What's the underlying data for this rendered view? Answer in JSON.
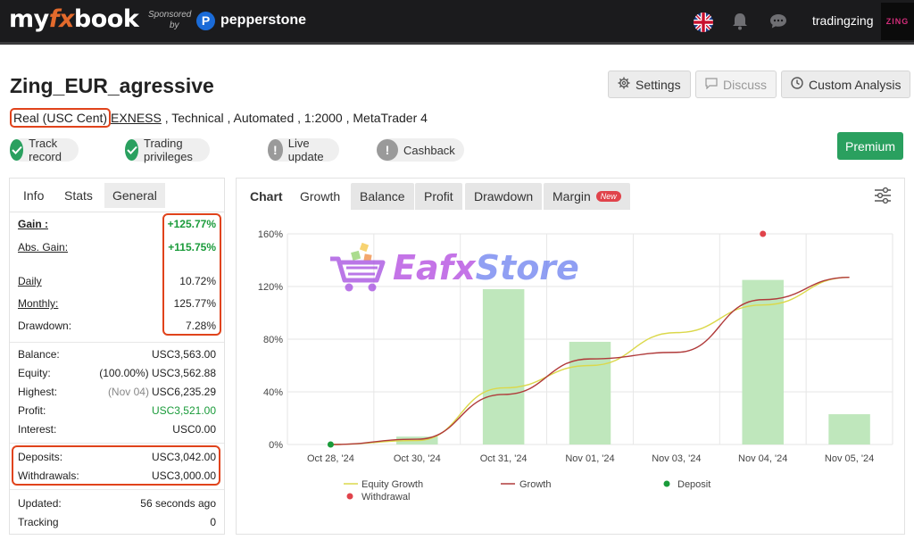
{
  "topbar": {
    "logo": {
      "pre": "my",
      "fx": "fx",
      "post": "book"
    },
    "sponsored": "Sponsored",
    "by": "by",
    "sponsor_badge": "P",
    "sponsor_name": "pepperstone",
    "flag_icon": "uk-flag-icon",
    "notifications_icon": "bell-icon",
    "messages_icon": "chat-icon",
    "username": "tradingzing",
    "avatar_text": "ZING"
  },
  "account": {
    "title": "Zing_EUR_agressive",
    "meta": {
      "type": "Real (USC Cent)",
      "broker": "EXNESS",
      "rest": " , Technical , Automated , 1:2000 , MetaTrader 4"
    }
  },
  "actions": {
    "settings": "Settings",
    "discuss": "Discuss",
    "custom_analysis": "Custom Analysis"
  },
  "badges": [
    {
      "label": "Track record",
      "status": "ok"
    },
    {
      "label": "Trading privileges",
      "status": "ok"
    },
    {
      "label": "Live update",
      "status": "warn"
    },
    {
      "label": "Cashback",
      "status": "warn"
    }
  ],
  "premium": "Premium",
  "left_tabs": [
    "Info",
    "Stats",
    "General"
  ],
  "stats": {
    "gain": {
      "label": "Gain :",
      "value": "+125.77%"
    },
    "abs_gain": {
      "label": "Abs. Gain:",
      "value": "+115.75%"
    },
    "daily": {
      "label": "Daily",
      "value": "10.72%"
    },
    "monthly": {
      "label": "Monthly:",
      "value": "125.77%"
    },
    "drawdown": {
      "label": "Drawdown:",
      "value": "7.28%"
    },
    "balance": {
      "label": "Balance:",
      "value": "USC3,563.00"
    },
    "equity": {
      "label": "Equity:",
      "note": "(100.00%)",
      "value": "USC3,562.88"
    },
    "highest": {
      "label": "Highest:",
      "note": "(Nov 04)",
      "value": "USC6,235.29"
    },
    "profit": {
      "label": "Profit:",
      "value": "USC3,521.00"
    },
    "interest": {
      "label": "Interest:",
      "value": "USC0.00"
    },
    "deposits": {
      "label": "Deposits:",
      "value": "USC3,042.00"
    },
    "withdrawals": {
      "label": "Withdrawals:",
      "value": "USC3,000.00"
    },
    "updated": {
      "label": "Updated:",
      "value": "56 seconds ago"
    },
    "tracking": {
      "label": "Tracking",
      "value": "0"
    }
  },
  "chart_tabs": {
    "chart": "Chart",
    "growth": "Growth",
    "balance": "Balance",
    "profit": "Profit",
    "drawdown": "Drawdown",
    "margin": "Margin",
    "new": "New"
  },
  "watermark": {
    "a": "Eafx",
    "b": "Store"
  },
  "colors": {
    "accent_green": "#2aa05f",
    "highlight_red": "#e0431b",
    "bar_green": "#bfe7bc",
    "growth_line": "#b03a3a",
    "equity_line": "#dbd84a",
    "deposit_dot": "#1a9b3a",
    "withdrawal_dot": "#e0434b"
  },
  "chart_data": {
    "type": "bar",
    "categories": [
      "Oct 28, '24",
      "Oct 30, '24",
      "Oct 31, '24",
      "Nov 01, '24",
      "Nov 03, '24",
      "Nov 04, '24",
      "Nov 05, '24"
    ],
    "y_ticks": [
      "0%",
      "40%",
      "80%",
      "120%",
      "160%"
    ],
    "ylim": [
      0,
      160
    ],
    "grid": true,
    "bars": [
      0,
      6,
      118,
      78,
      0,
      125,
      23
    ],
    "series": [
      {
        "name": "Equity Growth",
        "type": "line",
        "values": [
          0,
          3,
          43,
          60,
          85,
          106,
          127
        ]
      },
      {
        "name": "Growth",
        "type": "line",
        "values": [
          0,
          4,
          38,
          65,
          70,
          110,
          127
        ]
      }
    ],
    "markers": [
      {
        "name": "Deposit",
        "x_index": 0,
        "y": 0
      },
      {
        "name": "Withdrawal",
        "x_index": 5,
        "y": 160
      }
    ],
    "legend": [
      "Equity Growth",
      "Growth",
      "Deposit",
      "Withdrawal"
    ],
    "legend_position": "bottom"
  }
}
